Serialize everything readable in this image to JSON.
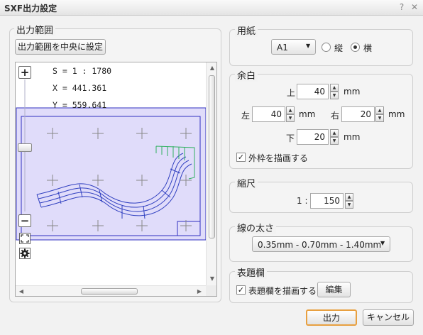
{
  "window": {
    "title": "SXF出力設定",
    "help_icon": "?",
    "close_icon": "✕"
  },
  "range": {
    "group_label": "出力範囲",
    "center_button": "出力範囲を中央に設定",
    "scale_text": "S = 1 : 1780",
    "x_text": "X = 441.361",
    "y_text": "Y = 559.641",
    "zoom_in": "+",
    "zoom_out": "−",
    "fit_icon": "fit-extent",
    "settings_icon": "gear"
  },
  "paper": {
    "group_label": "用紙",
    "size_value": "A1",
    "portrait_label": "縦",
    "landscape_label": "横",
    "orientation": "landscape"
  },
  "margin": {
    "group_label": "余白",
    "top_label": "上",
    "top_value": "40",
    "left_label": "左",
    "left_value": "40",
    "right_label": "右",
    "right_value": "20",
    "bottom_label": "下",
    "bottom_value": "20",
    "unit": "mm",
    "frame_checkbox_label": "外枠を描画する",
    "frame_checked": true
  },
  "scale": {
    "group_label": "縮尺",
    "prefix": "1 :",
    "value": "150"
  },
  "line_width": {
    "group_label": "線の太さ",
    "value": "0.35mm - 0.70mm - 1.40mm"
  },
  "title_block": {
    "group_label": "表題欄",
    "draw_checkbox_label": "表題欄を描画する",
    "draw_checked": true,
    "edit_button": "編集"
  },
  "footer": {
    "output_button": "出力",
    "cancel_button": "キャンセル"
  },
  "colors": {
    "accent": "#e8a040",
    "paper_fill": "#e0dcfa",
    "paper_border": "#3030c0",
    "road": "#3040c0",
    "road_end": "#30b060"
  }
}
